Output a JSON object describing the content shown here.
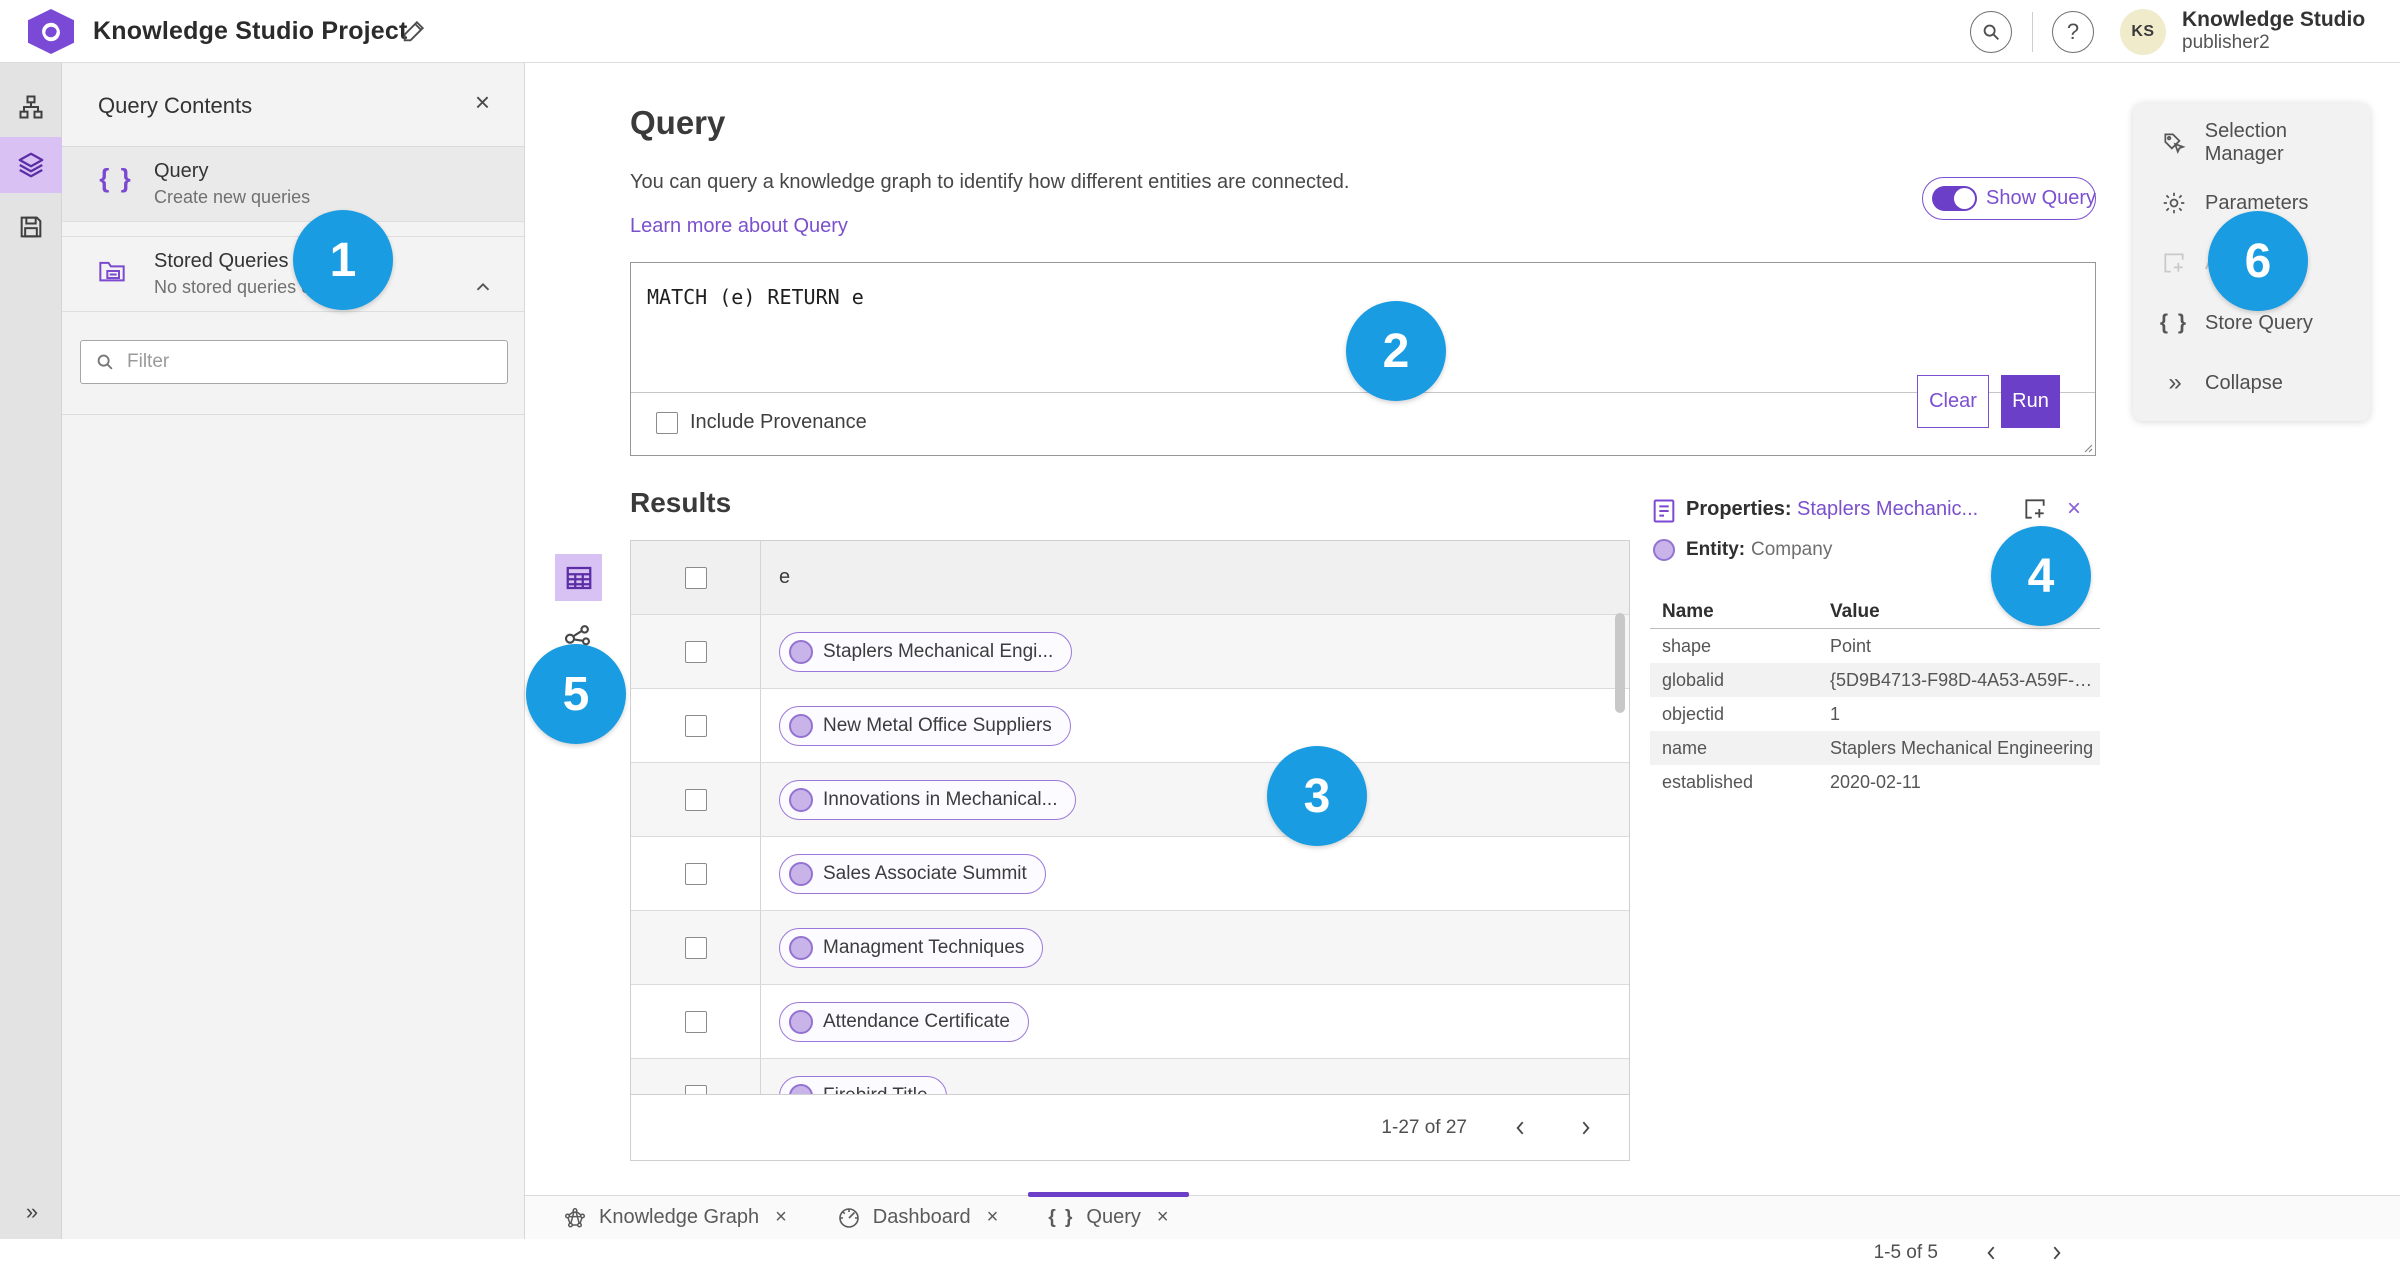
{
  "app": {
    "title": "Knowledge Studio Project",
    "user_name": "Knowledge Studio",
    "user_role": "publisher2",
    "avatar_initials": "KS",
    "help_glyph": "?"
  },
  "left_panel": {
    "header": "Query Contents",
    "close_glyph": "×",
    "items": [
      {
        "title": "Query",
        "subtitle": "Create new queries",
        "icon": "braces-icon",
        "icon_glyph": "{ }"
      },
      {
        "title": "Stored Queries",
        "subtitle": "No stored queries exist",
        "icon": "stored-queries-folder-icon"
      }
    ],
    "filter_placeholder": "Filter"
  },
  "rail": {
    "expand_glyph": "»"
  },
  "query": {
    "heading": "Query",
    "description": "You can query a knowledge graph to identify how different entities are connected.",
    "learn_more": "Learn more about Query",
    "show_query_label": "Show Query",
    "code": "MATCH (e) RETURN e",
    "include_provenance_label": "Include Provenance",
    "clear_label": "Clear",
    "run_label": "Run"
  },
  "results": {
    "heading": "Results",
    "column": "e",
    "rows": [
      "Staplers Mechanical Engi...",
      "New Metal Office Suppliers",
      "Innovations in Mechanical...",
      "Sales Associate Summit",
      "Managment Techniques",
      "Attendance Certificate",
      "Firebird Title"
    ],
    "pagination": "1-27 of 27"
  },
  "properties": {
    "title_label": "Properties:",
    "title_link": "Staplers Mechanic...",
    "close_glyph": "×",
    "entity_label": "Entity:",
    "entity_value": "Company",
    "col_name": "Name",
    "col_value": "Value",
    "rows": [
      {
        "name": "shape",
        "value": "Point"
      },
      {
        "name": "globalid",
        "value": "{5D9B4713-F98D-4A53-A59F-C11..."
      },
      {
        "name": "objectid",
        "value": "1"
      },
      {
        "name": "name",
        "value": "Staplers Mechanical Engineering"
      },
      {
        "name": "established",
        "value": "2020-02-11"
      }
    ],
    "pagination": "1-5 of 5"
  },
  "right_menu": {
    "items": [
      {
        "label": "Selection Manager",
        "icon": "selection-manager-icon",
        "disabled": false
      },
      {
        "label": "Parameters",
        "icon": "gear-icon",
        "disabled": false
      },
      {
        "label": "Ad",
        "icon": "add-frame-icon",
        "disabled": true
      },
      {
        "label": "Store Query",
        "icon": "braces-icon",
        "icon_glyph": "{ }",
        "disabled": false
      },
      {
        "label": "Collapse",
        "icon": "collapse-icon",
        "icon_glyph": "»",
        "disabled": false
      }
    ]
  },
  "tabs": [
    {
      "label": "Knowledge Graph",
      "icon": "knowledge-graph-icon",
      "close_glyph": "×",
      "active": false
    },
    {
      "label": "Dashboard",
      "icon": "dashboard-icon",
      "close_glyph": "×",
      "active": false
    },
    {
      "label": "Query",
      "icon": "braces-icon",
      "icon_glyph": "{ }",
      "close_glyph": "×",
      "active": true
    }
  ],
  "callouts": [
    "1",
    "2",
    "3",
    "4",
    "5",
    "6"
  ],
  "colors": {
    "accent": "#6b3fc8",
    "accent_light": "#d9c2f3",
    "link": "#7b50cc",
    "callout_blue": "#1a9ce2",
    "avatar_bg": "#f0eccb"
  }
}
